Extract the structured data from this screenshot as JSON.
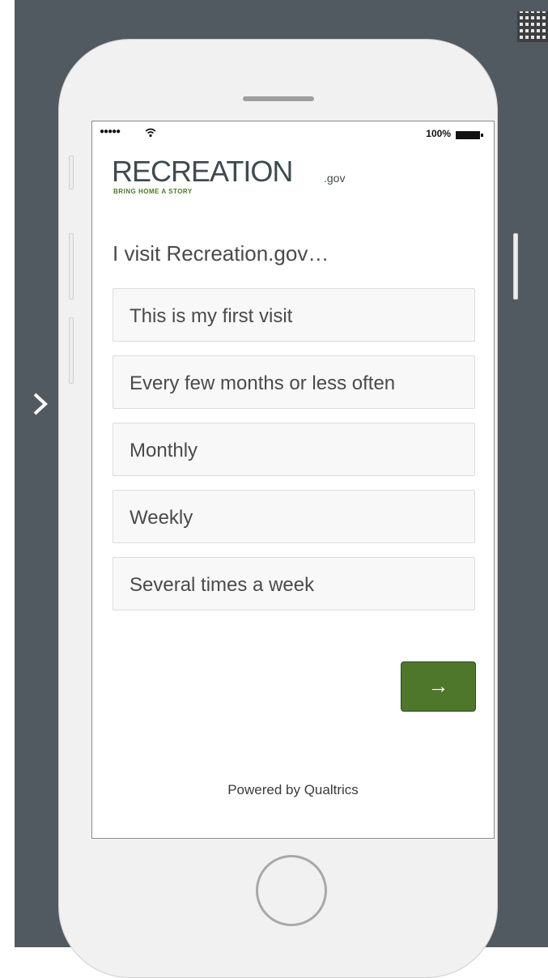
{
  "status_bar": {
    "signal": "●●●●●",
    "battery_percent": "100%"
  },
  "logo": {
    "wordmark": "RECREATION",
    "suffix": ".gov",
    "tagline": "BRING HOME A STORY"
  },
  "survey": {
    "question": "I visit Recreation.gov…",
    "choices": [
      "This is my first visit",
      "Every few months or less often",
      "Monthly",
      "Weekly",
      "Several times a week"
    ],
    "next_label": "→",
    "footer": "Powered by Qualtrics"
  },
  "colors": {
    "background": "#525a61",
    "accent": "#4e772c",
    "logo_green": "#4b7a2a"
  }
}
